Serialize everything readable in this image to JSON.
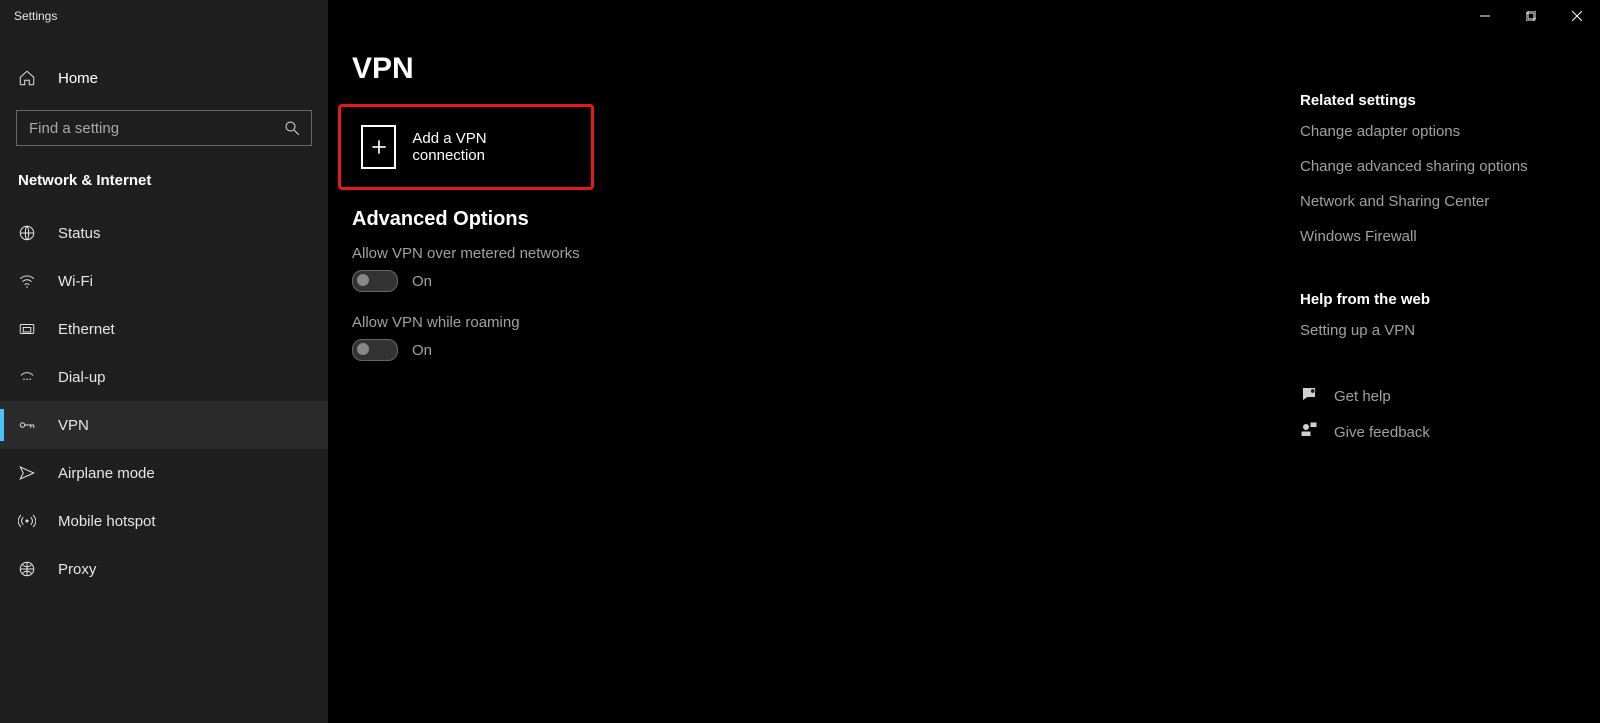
{
  "window": {
    "title": "Settings"
  },
  "sidebar": {
    "home_label": "Home",
    "search_placeholder": "Find a setting",
    "section_label": "Network & Internet",
    "items": [
      {
        "id": "status",
        "label": "Status",
        "icon": "status-icon"
      },
      {
        "id": "wifi",
        "label": "Wi-Fi",
        "icon": "wifi-icon"
      },
      {
        "id": "ethernet",
        "label": "Ethernet",
        "icon": "ethernet-icon"
      },
      {
        "id": "dialup",
        "label": "Dial-up",
        "icon": "dialup-icon"
      },
      {
        "id": "vpn",
        "label": "VPN",
        "icon": "vpn-icon",
        "active": true
      },
      {
        "id": "airplane",
        "label": "Airplane mode",
        "icon": "airplane-icon"
      },
      {
        "id": "hotspot",
        "label": "Mobile hotspot",
        "icon": "hotspot-icon"
      },
      {
        "id": "proxy",
        "label": "Proxy",
        "icon": "proxy-icon"
      }
    ]
  },
  "main": {
    "page_title": "VPN",
    "add_vpn_label": "Add a VPN connection",
    "advanced_heading": "Advanced Options",
    "toggles": [
      {
        "id": "metered",
        "label": "Allow VPN over metered networks",
        "state_label": "On",
        "on": true
      },
      {
        "id": "roaming",
        "label": "Allow VPN while roaming",
        "state_label": "On",
        "on": true
      }
    ]
  },
  "right": {
    "related_heading": "Related settings",
    "related_links": [
      "Change adapter options",
      "Change advanced sharing options",
      "Network and Sharing Center",
      "Windows Firewall"
    ],
    "help_heading": "Help from the web",
    "help_links": [
      "Setting up a VPN"
    ],
    "footer_links": [
      {
        "id": "gethelp",
        "label": "Get help",
        "icon": "chat-icon"
      },
      {
        "id": "feedback",
        "label": "Give feedback",
        "icon": "feedback-icon"
      }
    ]
  }
}
